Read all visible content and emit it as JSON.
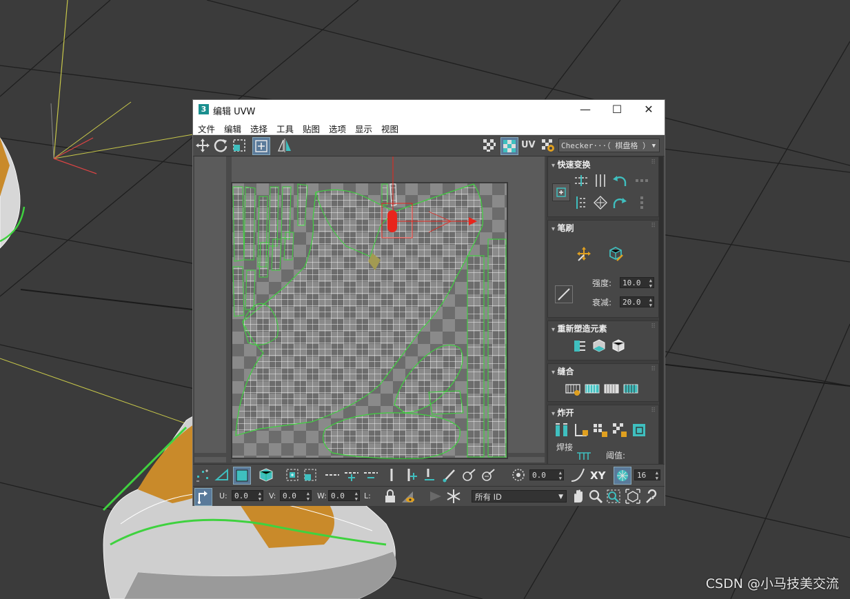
{
  "window": {
    "app_icon": "3",
    "title": "编辑 UVW",
    "controls": {
      "minimize": "—",
      "maximize": "☐",
      "close": "✕"
    }
  },
  "menu": [
    "文件",
    "编辑",
    "选择",
    "工具",
    "贴图",
    "选项",
    "显示",
    "视图"
  ],
  "toolbar_top": {
    "uv_label": "UV",
    "checker_selected": "Checker···（ 棋盘格 ）",
    "icons": [
      "move-icon",
      "rotate-icon",
      "scale-icon",
      "freeform-icon",
      "mirror-icon",
      "checker-off-icon",
      "checker-on-icon",
      "uv-icon",
      "checker-settings-icon"
    ]
  },
  "panel": {
    "quick_transform": {
      "title": "快速变换"
    },
    "brush": {
      "title": "笔刷",
      "strength_label": "强度:",
      "strength_value": "10.0",
      "falloff_label": "衰减:",
      "falloff_value": "20.0"
    },
    "reshape": {
      "title": "重新塑造元素"
    },
    "stitch": {
      "title": "缝合"
    },
    "explode": {
      "title": "炸开",
      "weld_label": "焊接",
      "threshold_label": "阈值:"
    }
  },
  "bottom": {
    "soft_value": "0.0",
    "xy_label": "XY",
    "grid_value": "16",
    "u_label": "U:",
    "u_value": "0.0",
    "v_label": "V:",
    "v_value": "0.0",
    "w_label": "W:",
    "w_value": "0.0",
    "l_label": "L:",
    "id_filter": "所有 ID"
  },
  "watermark": "CSDN @小马技美交流",
  "colors": {
    "accent_teal": "#3fbfbf",
    "seam_green": "#3fd23f",
    "gizmo_red": "#e8251c",
    "viewport_bg": "#3b3b3b"
  }
}
